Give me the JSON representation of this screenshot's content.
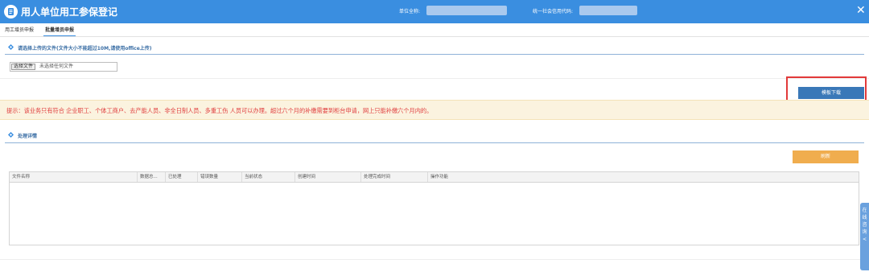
{
  "header": {
    "title": "用人单位用工参保登记",
    "org_label": "单位全称:",
    "code_label": "统一社会信用代码:",
    "close_icon": "close-icon"
  },
  "tabs": [
    {
      "label": "用工增员申报",
      "active": false
    },
    {
      "label": "批量增员申报",
      "active": true
    }
  ],
  "upload": {
    "section_title": "请选择上传的文件(文件大小不能超过10M,请使用office上传)",
    "choose_button": "选择文件",
    "file_status": "未选择任何文件"
  },
  "download_button": "模板下载",
  "notice": "提示：该业务只有符合 企业职工、个体工商户、去产能人员、非全日制人员、多重工伤 人员可以办理。超过六个月的补缴需要到柜台申请，网上只能补缴六个月内的。",
  "details": {
    "section_title": "处理详情",
    "refresh_button": "刷新"
  },
  "table": {
    "columns": [
      "文件名称",
      "数据总...",
      "已处理",
      "错误数量",
      "当前状态",
      "创建时间",
      "处理完成时间",
      "操作功能"
    ],
    "rows": []
  },
  "side_tab": [
    "在",
    "线",
    "咨",
    "询",
    "<"
  ],
  "colors": {
    "header": "#3a8ee0",
    "primary_button": "#3a78b8",
    "refresh_button": "#f0ad4e",
    "notice_text": "#e04040",
    "highlight_frame": "#e23a3a"
  }
}
